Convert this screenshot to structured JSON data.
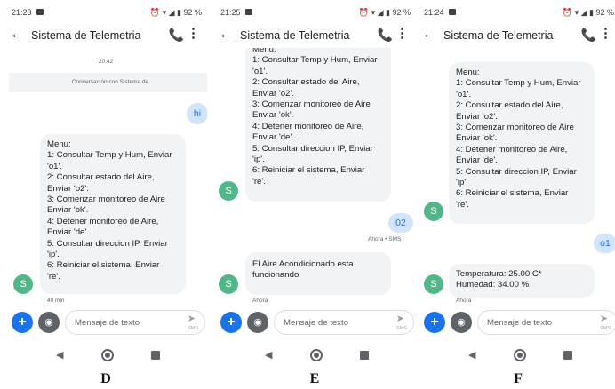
{
  "app": {
    "title": "Sistema de Telemetria",
    "compose_placeholder": "Mensaje de texto",
    "send_label": "SMS",
    "avatar_letter": "S"
  },
  "status": {
    "signal_battery": "⏰ ▾ ◢ ▮ 92 %"
  },
  "menu_lines": [
    "Menu:",
    "1: Consultar Temp y Hum, Enviar",
    "'o1'.",
    "2: Consultar estado del Aire,",
    "Enviar 'o2'.",
    "3: Comenzar monitoreo de Aire",
    "Enviar 'ok'.",
    "4: Detener monitoreo de Aire,",
    "Enviar 'de'.",
    "5: Consultar direccion IP, Enviar",
    "'ip'.",
    "6: Reiniciar el sistema, Enviar",
    "'re'."
  ],
  "panels": {
    "d": {
      "caption": "D",
      "time": "21:23",
      "timestamp": "20:42",
      "banner": "Conversación con Sistema de",
      "sent": "hi",
      "received_meta": "40 min"
    },
    "e": {
      "caption": "E",
      "time": "21:25",
      "sent": "02",
      "sent_meta": "Ahora • SMS",
      "reply_lines": [
        "El Aire Acondicionado esta",
        "funcionando"
      ],
      "reply_meta": "Ahora"
    },
    "f": {
      "caption": "F",
      "time": "21:24",
      "sent": "o1",
      "reply_lines": [
        "Temperatura: 25.00 C*",
        "Humedad: 34.00 %"
      ],
      "reply_meta": "Ahora"
    }
  },
  "colors": {
    "accent": "#1a73e8",
    "avatar": "#52b788",
    "incoming_bubble": "#f1f3f4",
    "outgoing_bubble": "#d2e3fc"
  }
}
